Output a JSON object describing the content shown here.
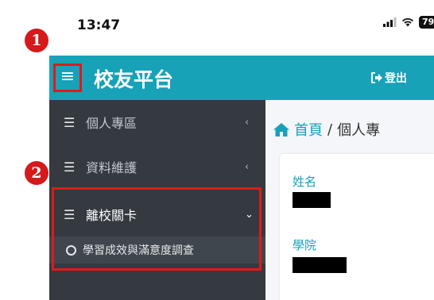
{
  "status_bar": {
    "time": "13:47",
    "signal_icon": "signal-bars-icon",
    "wifi_icon": "wifi-icon",
    "battery": "79"
  },
  "header": {
    "menu_icon": "hamburger-menu-icon",
    "brand": "校友平台",
    "logout_icon": "sign-out-icon",
    "logout": "登出",
    "accent_color": "#17a2b8"
  },
  "sidebar": {
    "items": [
      {
        "label": "個人專區",
        "icon": "list-icon",
        "chevron": "‹"
      },
      {
        "label": "資料維護",
        "icon": "list-icon",
        "chevron": "‹"
      },
      {
        "label": "離校關卡",
        "icon": "list-icon",
        "chevron": "⌄",
        "expanded": true
      }
    ],
    "subitems": [
      {
        "label": "學習成效與滿意度調查",
        "icon": "circle-icon"
      }
    ],
    "background": "#343a40"
  },
  "breadcrumb": {
    "home_icon": "home-icon",
    "home": "首頁",
    "separator": "/",
    "current": "個人專"
  },
  "profile": {
    "fields": [
      {
        "label": "姓名",
        "value_redacted": true
      },
      {
        "label": "學院",
        "value_redacted": true
      }
    ]
  },
  "annotations": {
    "markers": [
      "1",
      "2"
    ],
    "color": "#e01919"
  }
}
